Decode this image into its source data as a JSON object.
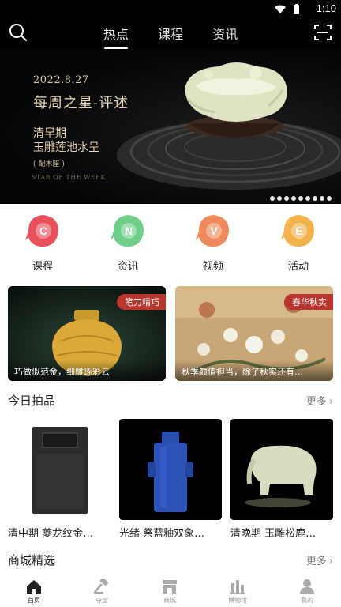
{
  "status": {
    "time": "1:10"
  },
  "tabs": [
    {
      "label": "热点"
    },
    {
      "label": "课程"
    },
    {
      "label": "资讯"
    }
  ],
  "banner": {
    "date": "2022.8.27",
    "title": "每周之星-评述",
    "subtitle_line1": "清早期",
    "subtitle_line2": "玉雕莲池水呈",
    "note": "( 配木座 )",
    "english": "STAR OF THE WEEK",
    "dot_count": 9
  },
  "quick_entries": [
    {
      "label": "课程",
      "letter": "C",
      "color": "#e8515a",
      "icon": "course-icon"
    },
    {
      "label": "资讯",
      "letter": "N",
      "color": "#6fcf8a",
      "icon": "news-icon"
    },
    {
      "label": "视频",
      "letter": "V",
      "color": "#f08a5d",
      "icon": "video-icon"
    },
    {
      "label": "活动",
      "letter": "E",
      "color": "#f2b24c",
      "icon": "event-icon"
    }
  ],
  "feature_cards": [
    {
      "tag": "笔刀精巧",
      "caption": "巧做似范金，细雕琢彩云"
    },
    {
      "tag": "春华秋实",
      "caption": "秋季颇值担当，除了秋实还有…"
    }
  ],
  "today_auction": {
    "title": "今日拍品",
    "more": "更多",
    "items": [
      {
        "title": "清中期 夔龙纹金…"
      },
      {
        "title": "光绪 祭蓝釉双象…"
      },
      {
        "title": "清晚期 玉雕松鹿…"
      }
    ]
  },
  "mall": {
    "title": "商城精选",
    "more": "更多"
  },
  "bottom_nav": [
    {
      "label": "首页",
      "icon": "home-icon",
      "active": true
    },
    {
      "label": "夺宝",
      "icon": "hammer-icon",
      "active": false
    },
    {
      "label": "商城",
      "icon": "store-icon",
      "active": false
    },
    {
      "label": "博物馆",
      "icon": "museum-icon",
      "active": false
    },
    {
      "label": "我的",
      "icon": "profile-icon",
      "active": false
    }
  ]
}
